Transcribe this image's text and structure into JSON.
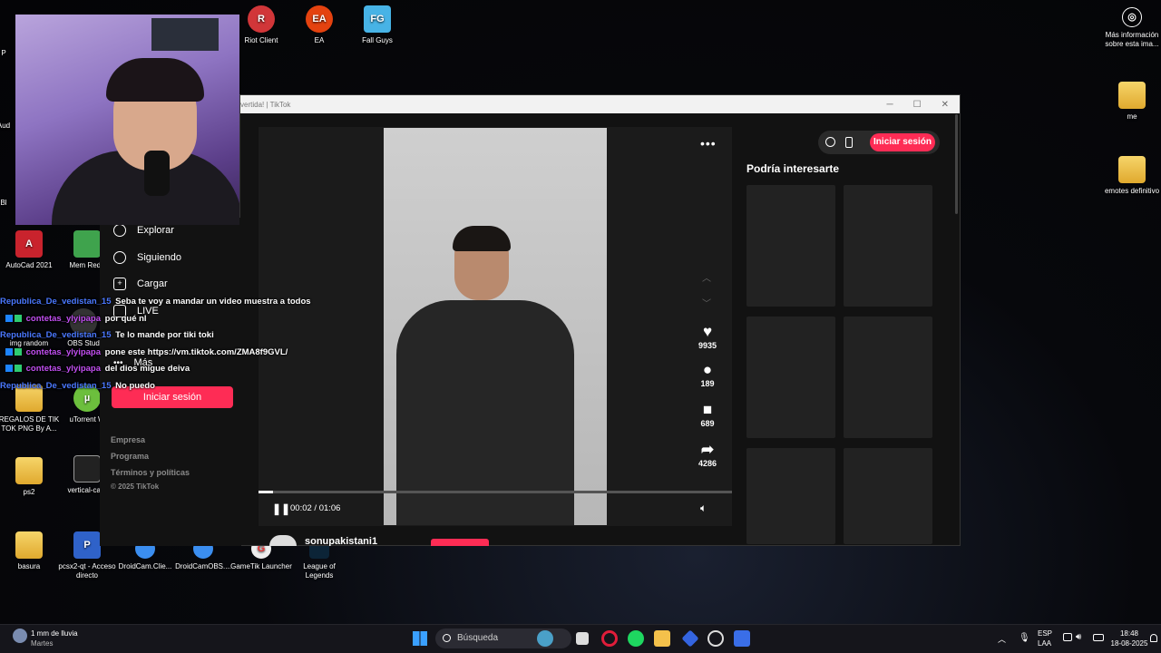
{
  "desktop_icons": [
    {
      "label": "Riot Client",
      "icon": "riot-client-icon",
      "color": "#d13639"
    },
    {
      "label": "EA",
      "icon": "ea-icon",
      "color": "#e4420f"
    },
    {
      "label": "Fall Guys",
      "icon": "fall-guys-icon",
      "color": "#47b3e6"
    },
    {
      "label": "Más información sobre esta ima...",
      "icon": "camera-info-icon"
    },
    {
      "label": "me",
      "icon": "folder-icon"
    },
    {
      "label": "emotes definitivo",
      "icon": "folder-icon"
    },
    {
      "label": "AutoCad 2021",
      "icon": "autocad-icon",
      "color": "#c9232d"
    },
    {
      "label": "Mem Redu",
      "icon": "mem-reduct-icon"
    },
    {
      "label": "REGALOS DE TIK TOK PNG By A...",
      "icon": "folder-icon"
    },
    {
      "label": "uTorrent W",
      "icon": "utorrent-icon"
    },
    {
      "label": "ps2",
      "icon": "folder-icon"
    },
    {
      "label": "vertical-cam",
      "icon": "file-icon"
    },
    {
      "label": "basura",
      "icon": "folder-icon"
    },
    {
      "label": "pcsx2-qt - Acceso directo",
      "icon": "pcsx2-icon"
    },
    {
      "label": "DroidCam.Clie...",
      "icon": "droidcam-icon"
    },
    {
      "label": "DroidCamOBS....",
      "icon": "droidcam-icon"
    },
    {
      "label": "GameTik Launcher",
      "icon": "gametik-icon"
    },
    {
      "label": "League of Legends",
      "icon": "league-icon"
    },
    {
      "label": "Aud",
      "icon": "app-icon"
    },
    {
      "label": "Bl",
      "icon": "app-icon"
    },
    {
      "label": "P",
      "icon": "app-icon"
    },
    {
      "label": "img random",
      "icon": "app-icon"
    },
    {
      "label": "OBS Stud",
      "icon": "obs-icon"
    }
  ],
  "browser": {
    "title": "vertida! | TikTok",
    "sidebar": {
      "nav": [
        "Explorar",
        "Siguiendo",
        "Cargar",
        "LIVE",
        "Más"
      ],
      "login": "Iniciar sesión",
      "footer": [
        "Empresa",
        "Programa",
        "Términos y políticas",
        "© 2025 TikTok"
      ]
    },
    "video": {
      "likes": "9935",
      "comments": "189",
      "saves": "689",
      "shares": "4286",
      "time": "00:02 / 01:06",
      "progress": 0.03,
      "author": "sonupakistani1"
    },
    "header_login": "Iniciar sesión",
    "recommended_title": "Podría interesarte"
  },
  "chat": [
    {
      "user": "Republica_De_vedistan_15",
      "msg": "Seba te voy a mandar un video muestra a todos",
      "color": "#4a78ff"
    },
    {
      "user": "contetas_ylyipapa",
      "msg": "por qué nl",
      "color": "#c24ff2"
    },
    {
      "user": "Republica_De_vedistan_15",
      "msg": "Te lo mande por tiki toki",
      "color": "#4a78ff"
    },
    {
      "user": "contetas_ylyipapa",
      "msg": "pone este https://vm.tiktok.com/ZMA8f9GVL/",
      "color": "#c24ff2"
    },
    {
      "user": "contetas_ylyipapa",
      "msg": "del dios migue deiva",
      "color": "#c24ff2"
    },
    {
      "user": "Republica_De_vedistan_15",
      "msg": "No puedo",
      "color": "#4a78ff"
    }
  ],
  "taskbar": {
    "weather": "1 mm de lluvia",
    "weather_day": "Martes",
    "search_placeholder": "Búsqueda",
    "lang": "ESP",
    "lang2": "LAA",
    "time": "18:48",
    "date": "18-08-2025"
  }
}
